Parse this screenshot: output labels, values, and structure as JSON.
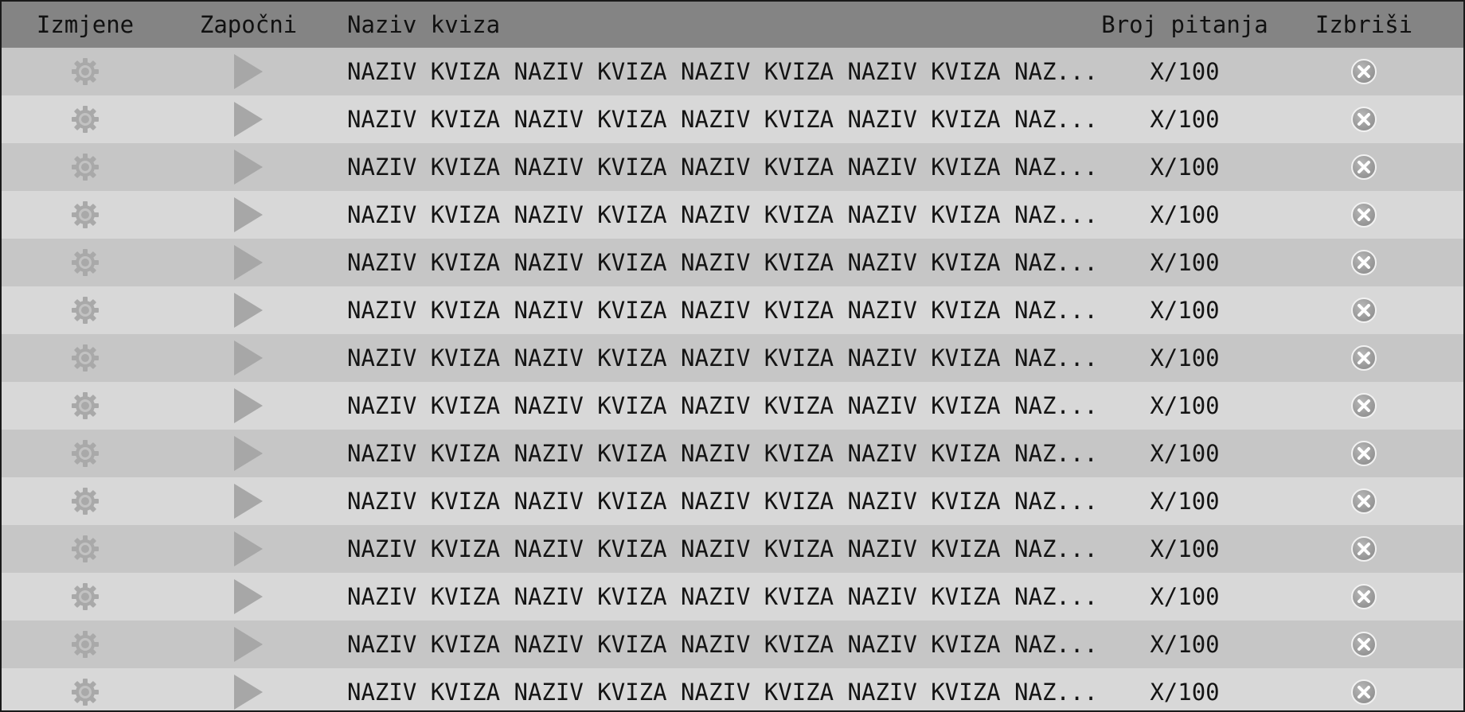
{
  "table": {
    "headers": {
      "edit": "Izmjene",
      "start": "Započni",
      "name": "Naziv kviza",
      "count": "Broj pitanja",
      "delete": "Izbriši"
    },
    "rows": [
      {
        "name": "NAZIV KVIZA NAZIV KVIZA NAZIV KVIZA NAZIV KVIZA NAZ...",
        "count": "X/100"
      },
      {
        "name": "NAZIV KVIZA NAZIV KVIZA NAZIV KVIZA NAZIV KVIZA NAZ...",
        "count": "X/100"
      },
      {
        "name": "NAZIV KVIZA NAZIV KVIZA NAZIV KVIZA NAZIV KVIZA NAZ...",
        "count": "X/100"
      },
      {
        "name": "NAZIV KVIZA NAZIV KVIZA NAZIV KVIZA NAZIV KVIZA NAZ...",
        "count": "X/100"
      },
      {
        "name": "NAZIV KVIZA NAZIV KVIZA NAZIV KVIZA NAZIV KVIZA NAZ...",
        "count": "X/100"
      },
      {
        "name": "NAZIV KVIZA NAZIV KVIZA NAZIV KVIZA NAZIV KVIZA NAZ...",
        "count": "X/100"
      },
      {
        "name": "NAZIV KVIZA NAZIV KVIZA NAZIV KVIZA NAZIV KVIZA NAZ...",
        "count": "X/100"
      },
      {
        "name": "NAZIV KVIZA NAZIV KVIZA NAZIV KVIZA NAZIV KVIZA NAZ...",
        "count": "X/100"
      },
      {
        "name": "NAZIV KVIZA NAZIV KVIZA NAZIV KVIZA NAZIV KVIZA NAZ...",
        "count": "X/100"
      },
      {
        "name": "NAZIV KVIZA NAZIV KVIZA NAZIV KVIZA NAZIV KVIZA NAZ...",
        "count": "X/100"
      },
      {
        "name": "NAZIV KVIZA NAZIV KVIZA NAZIV KVIZA NAZIV KVIZA NAZ...",
        "count": "X/100"
      },
      {
        "name": "NAZIV KVIZA NAZIV KVIZA NAZIV KVIZA NAZIV KVIZA NAZ...",
        "count": "X/100"
      },
      {
        "name": "NAZIV KVIZA NAZIV KVIZA NAZIV KVIZA NAZIV KVIZA NAZ...",
        "count": "X/100"
      },
      {
        "name": "NAZIV KVIZA NAZIV KVIZA NAZIV KVIZA NAZIV KVIZA NAZ...",
        "count": "X/100"
      }
    ],
    "row_icons": {
      "edit": "gear-icon",
      "start": "play-icon",
      "delete": "close-circle-icon"
    }
  },
  "colors": {
    "header_bg": "#848484",
    "row_odd_bg": "#c6c6c6",
    "row_even_bg": "#d8d8d8",
    "icon_gray": "#a9a9a9"
  }
}
